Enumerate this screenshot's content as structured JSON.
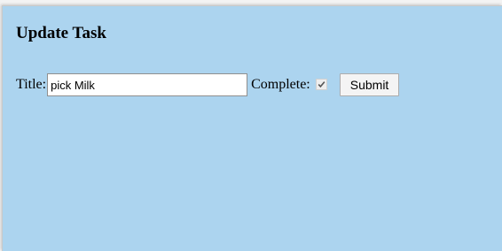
{
  "page": {
    "heading": "Update Task"
  },
  "form": {
    "title_label": "Title:",
    "title_value": "pick Milk",
    "complete_label": "Complete:",
    "complete_checked": true,
    "submit_label": "Submit"
  },
  "colors": {
    "panel_background": "#acd4ef",
    "page_background": "#f3f3f3"
  }
}
